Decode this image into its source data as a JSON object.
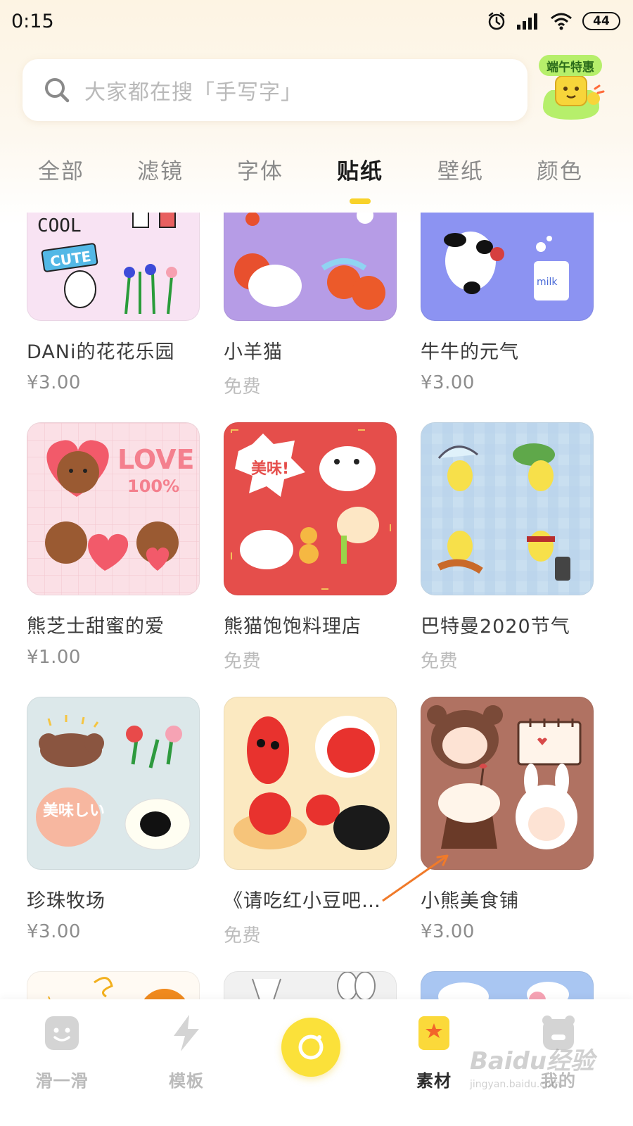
{
  "status_bar": {
    "time": "0:15",
    "battery": "44"
  },
  "search": {
    "placeholder": "大家都在搜「手写字」"
  },
  "promo": {
    "tag": "端午特惠"
  },
  "tabs": [
    {
      "label": "全部"
    },
    {
      "label": "滤镜"
    },
    {
      "label": "字体"
    },
    {
      "label": "贴纸",
      "active": true
    },
    {
      "label": "壁纸"
    },
    {
      "label": "颜色"
    }
  ],
  "stickers": [
    {
      "title": "DANi的花花乐园",
      "price": "¥3.00",
      "thumb_text": "COOL",
      "thumb_badge": "CUTE",
      "bg": "#f8e3f3"
    },
    {
      "title": "小羊猫",
      "price": "免费",
      "bg": "#b69ce6"
    },
    {
      "title": "牛牛的元气",
      "price": "¥3.00",
      "thumb_text": "milk",
      "bg": "#8c93f2"
    },
    {
      "title": "熊芝士甜蜜的爱",
      "price": "¥1.00",
      "thumb_text": "LOVE",
      "thumb_badge": "100%",
      "bg": "#fbe0e6"
    },
    {
      "title": "熊猫饱饱料理店",
      "price": "免费",
      "thumb_text": "美味!",
      "bg": "#e54e4b"
    },
    {
      "title": "巴特曼2020节气",
      "price": "免费",
      "bg": "#c9dff0"
    },
    {
      "title": "珍珠牧场",
      "price": "¥3.00",
      "thumb_text": "美味しい",
      "bg": "#dce8ea"
    },
    {
      "title": "《请吃红小豆吧！》",
      "price": "免费",
      "bg": "#fbe9c1"
    },
    {
      "title": "小熊美食铺",
      "price": "¥3.00",
      "bg": "#b07262"
    }
  ],
  "bottom_nav": [
    {
      "label": "滑一滑"
    },
    {
      "label": "模板"
    },
    {
      "label": "素材",
      "active": true
    },
    {
      "label": "我的"
    }
  ],
  "watermark": {
    "brand": "Baidu经验",
    "url": "jingyan.baidu.com"
  },
  "colors": {
    "accent": "#f8d22a",
    "camera": "#fbe13a"
  }
}
